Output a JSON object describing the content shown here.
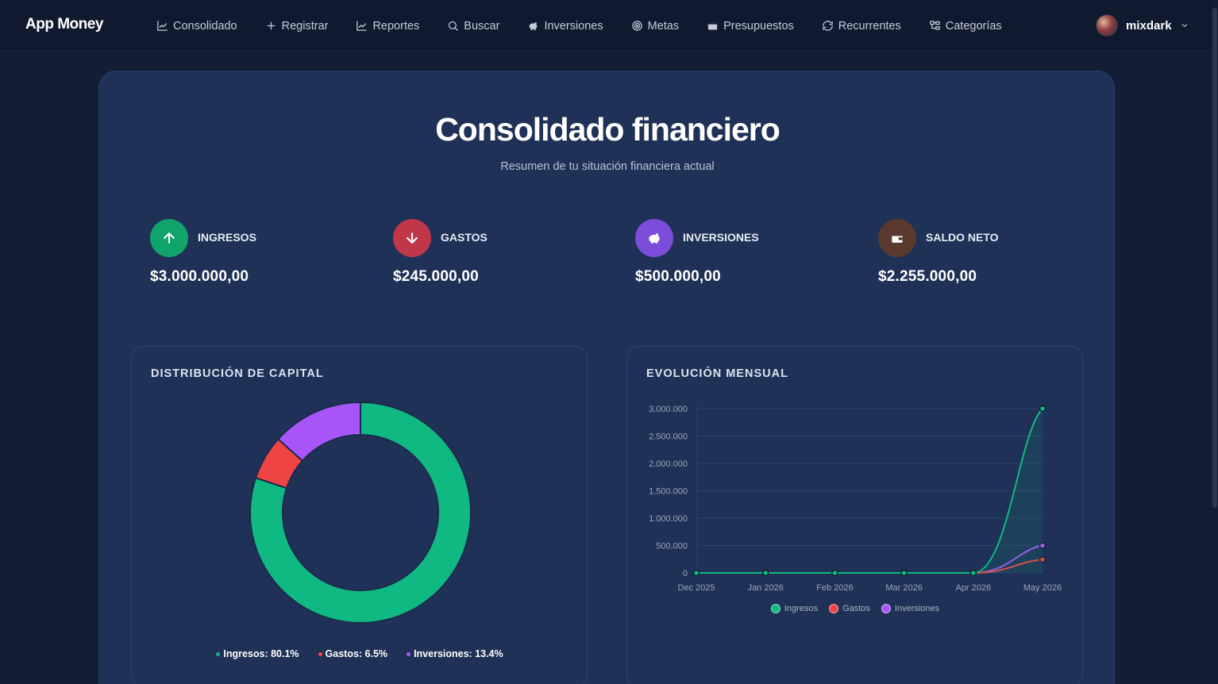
{
  "app": {
    "brand": "App Money"
  },
  "nav": {
    "items": [
      {
        "label": "Consolidado",
        "icon": "chart-line-icon"
      },
      {
        "label": "Registrar",
        "icon": "plus-icon"
      },
      {
        "label": "Reportes",
        "icon": "chart-line-icon"
      },
      {
        "label": "Buscar",
        "icon": "search-icon"
      },
      {
        "label": "Inversiones",
        "icon": "piggy-bank-icon"
      },
      {
        "label": "Metas",
        "icon": "target-icon"
      },
      {
        "label": "Presupuestos",
        "icon": "wallet-icon"
      },
      {
        "label": "Recurrentes",
        "icon": "refresh-icon"
      },
      {
        "label": "Categorías",
        "icon": "folder-tree-icon"
      }
    ],
    "user": {
      "name": "mixdark"
    }
  },
  "page": {
    "title": "Consolidado financiero",
    "subtitle": "Resumen de tu situación financiera actual"
  },
  "stats": [
    {
      "label": "INGRESOS",
      "value": "$3.000.000,00",
      "icon": "arrow-up-icon",
      "color": "#10a36a"
    },
    {
      "label": "GASTOS",
      "value": "$245.000,00",
      "icon": "arrow-down-icon",
      "color": "#c0374a"
    },
    {
      "label": "INVERSIONES",
      "value": "$500.000,00",
      "icon": "piggy-bank-icon",
      "color": "#7c4ddb"
    },
    {
      "label": "SALDO NETO",
      "value": "$2.255.000,00",
      "icon": "wallet-icon",
      "color": "#5a3a2e"
    }
  ],
  "distribution": {
    "title": "DISTRIBUCIÓN DE CAPITAL",
    "legend": [
      {
        "label": "Ingresos: 80.1%",
        "color": "#10b981"
      },
      {
        "label": "Gastos: 6.5%",
        "color": "#ef4444"
      },
      {
        "label": "Inversiones: 13.4%",
        "color": "#a855f7"
      }
    ]
  },
  "evolution": {
    "title": "EVOLUCIÓN MENSUAL"
  },
  "chart_data": [
    {
      "type": "pie",
      "title": "DISTRIBUCIÓN DE CAPITAL",
      "categories": [
        "Ingresos",
        "Gastos",
        "Inversiones"
      ],
      "values": [
        80.1,
        6.5,
        13.4
      ],
      "colors": [
        "#10b981",
        "#ef4444",
        "#a855f7"
      ],
      "donut": true
    },
    {
      "type": "line",
      "title": "EVOLUCIÓN MENSUAL",
      "x": [
        "Dec 2025",
        "Jan 2026",
        "Feb 2026",
        "Mar 2026",
        "Apr 2026",
        "May 2026"
      ],
      "series": [
        {
          "name": "Ingresos",
          "color": "#10b981",
          "values": [
            0,
            0,
            0,
            0,
            0,
            3000000
          ]
        },
        {
          "name": "Gastos",
          "color": "#ef4444",
          "values": [
            0,
            0,
            0,
            0,
            0,
            245000
          ]
        },
        {
          "name": "Inversiones",
          "color": "#a855f7",
          "values": [
            0,
            0,
            0,
            0,
            0,
            500000
          ]
        }
      ],
      "yticks": [
        "0",
        "500.000",
        "1.000.000",
        "1.500.000",
        "2.000.000",
        "2.500.000",
        "3.000.000"
      ],
      "ylim": [
        0,
        3000000
      ],
      "grid": true,
      "legend": "bottom"
    }
  ]
}
